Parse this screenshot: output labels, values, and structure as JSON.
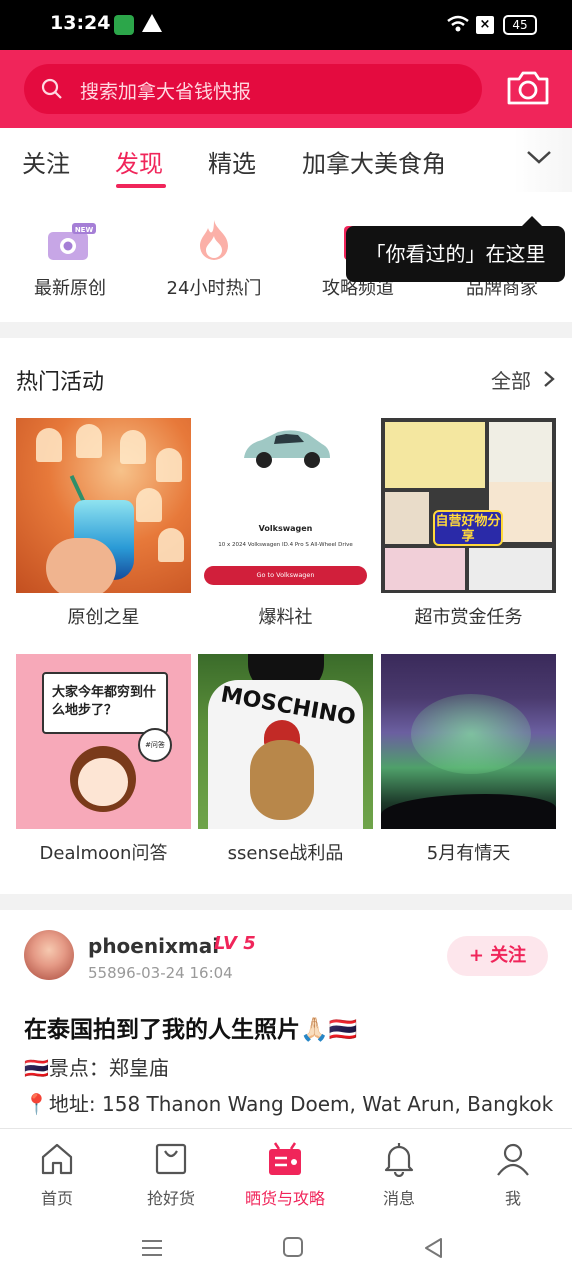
{
  "status_bar": {
    "time": "13:24",
    "battery": "45"
  },
  "header": {
    "search_placeholder": "搜索加拿大省钱快报",
    "accent": "#f0255a"
  },
  "tabs": [
    {
      "label": "关注",
      "active": false
    },
    {
      "label": "发现",
      "active": true
    },
    {
      "label": "精选",
      "active": false
    },
    {
      "label": "加拿大美食角",
      "active": false
    }
  ],
  "quick_links": [
    {
      "label": "最新原创",
      "icon": "camera-new-icon",
      "badge": "NEW"
    },
    {
      "label": "24小时热门",
      "icon": "flame-icon"
    },
    {
      "label": "攻略频道",
      "icon": "book-icon"
    },
    {
      "label": "品牌商家",
      "icon": "store-icon"
    }
  ],
  "tooltip": "「你看过的」在这里",
  "hot_activities": {
    "title": "热门活动",
    "see_all": "全部",
    "cards": [
      {
        "caption": "原创之星"
      },
      {
        "caption": "爆料社",
        "ad_brand": "Volkswagen",
        "ad_desc": "10 x 2024 Volkswagen ID.4 Pro S All-Wheel Drive",
        "ad_button": "Go to Volkswagen"
      },
      {
        "caption": "超市赏金任务",
        "promo": "自营好物分享"
      },
      {
        "caption": "Dealmoon问答",
        "board_text": "大家今年都穷到什么地步了？",
        "badge": "#问答"
      },
      {
        "caption": "ssense战利品",
        "shirt_text": "MOSCHINO"
      },
      {
        "caption": "5月有情天"
      }
    ]
  },
  "post": {
    "username": "phoenixmai",
    "level": "LV 5",
    "timestamp": "55896-03-24 16:04",
    "follow_label": "+ 关注",
    "title": "在泰国拍到了我的人生照片🙏🏻🇹🇭",
    "line1": "🇹🇭景点：郑皇庙",
    "line2": "📍地址: 158 Thanon Wang Doem, Wat Arun, Bangkok"
  },
  "bottom_nav": [
    {
      "label": "首页",
      "icon": "home-icon",
      "active": false
    },
    {
      "label": "抢好货",
      "icon": "shopping-bag-icon",
      "active": false
    },
    {
      "label": "晒货与攻略",
      "icon": "post-icon",
      "active": true
    },
    {
      "label": "消息",
      "icon": "bell-icon",
      "active": false
    },
    {
      "label": "我",
      "icon": "user-icon",
      "active": false
    }
  ]
}
